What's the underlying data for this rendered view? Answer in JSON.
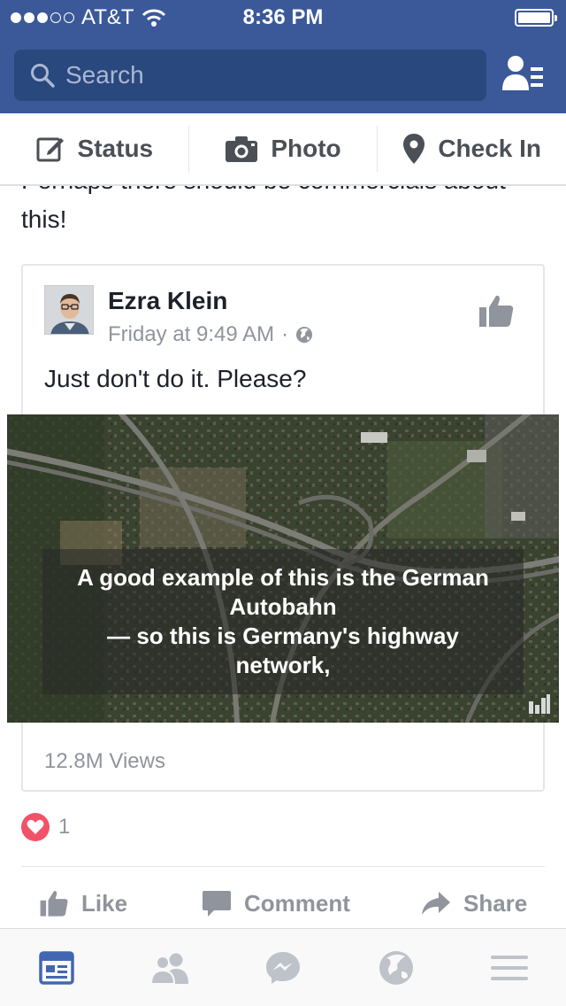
{
  "status_bar": {
    "carrier": "AT&T",
    "time": "8:36 PM"
  },
  "search": {
    "placeholder": "Search"
  },
  "composer": {
    "status_label": "Status",
    "photo_label": "Photo",
    "checkin_label": "Check In"
  },
  "feed": {
    "previous_post_text": "Perhaps there should be commercials about this!",
    "shared_post": {
      "author": "Ezra Klein",
      "timestamp": "Friday at 9:49 AM",
      "separator": "·",
      "text": "Just don't do it. Please?",
      "video_caption_lines": [
        "A good example of this is the German",
        "Autobahn",
        "— so this is Germany's highway",
        "network,"
      ],
      "views": "12.8M Views"
    },
    "reaction_count": "1",
    "actions": {
      "like": "Like",
      "comment": "Comment",
      "share": "Share"
    }
  },
  "tabs": [
    "news-feed",
    "requests",
    "messenger",
    "notifications",
    "more"
  ],
  "colors": {
    "brand": "#3b5998",
    "search_bg": "#29487d",
    "active_tab": "#4267b2",
    "icon_gray": "#bec3c9",
    "heart": "#f25268"
  }
}
